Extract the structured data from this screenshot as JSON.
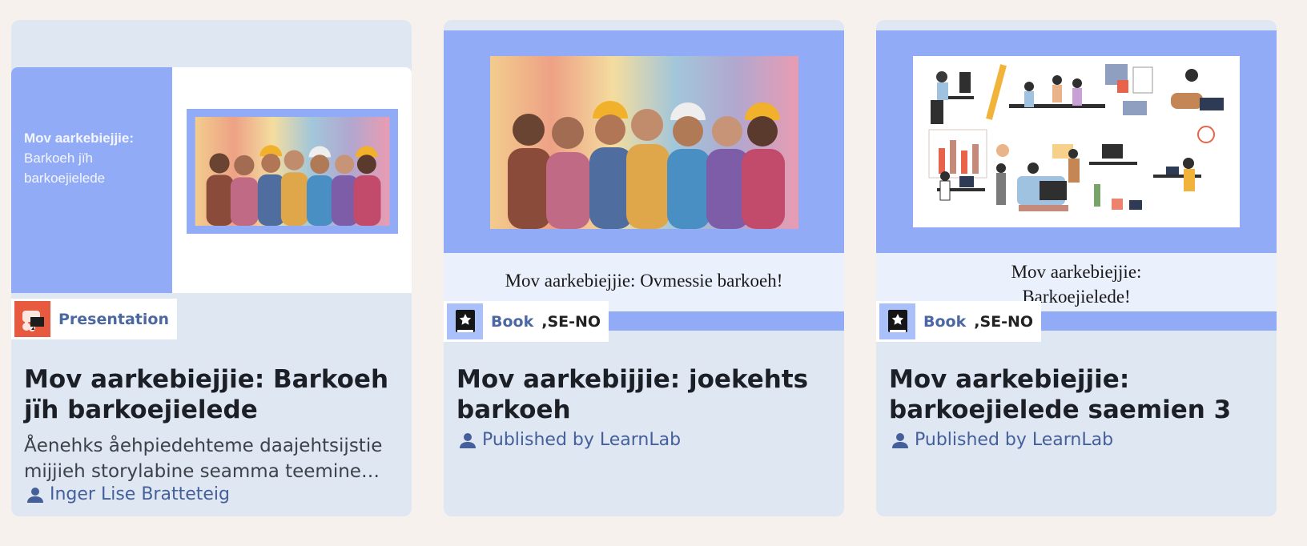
{
  "cards": [
    {
      "slide": {
        "title_bold": "Mov aarkebiejjie:",
        "title_rest_1": "Barkoeh jïh",
        "title_rest_2": "barkoejielede"
      },
      "badge": {
        "icon": "presentation-icon",
        "type": "Presentation"
      },
      "title": "Mov aarkebiejjie: Barkoeh jïh barkoejielede",
      "description": "Åenehks åehpiedehteme daajehtsijstie mijjieh storylabine seamma teemine…",
      "author": "Inger Lise Bratteteig"
    },
    {
      "cover_caption": "Mov aarkebiejjie: Ovmessie barkoeh!",
      "badge": {
        "icon": "book-icon",
        "type": "Book",
        "lang": ",SE-NO"
      },
      "title": "Mov aarkebijjie: joekehts barkoeh",
      "author": "Published by LearnLab"
    },
    {
      "cover_caption_1": "Mov aarkebiejjie:",
      "cover_caption_2": "Barkoejielede!",
      "badge": {
        "icon": "book-icon",
        "type": "Book",
        "lang": ",SE-NO"
      },
      "title": "Mov aarkebiejjie: barkoejielede saemien 3",
      "author": "Published by LearnLab"
    }
  ],
  "colors": {
    "page_bg": "#f6f1ed",
    "card_bg": "#dfe7f3",
    "accent_blue": "#91abf7",
    "presentation_orange": "#e85a3f",
    "link_blue": "#455f9a"
  }
}
